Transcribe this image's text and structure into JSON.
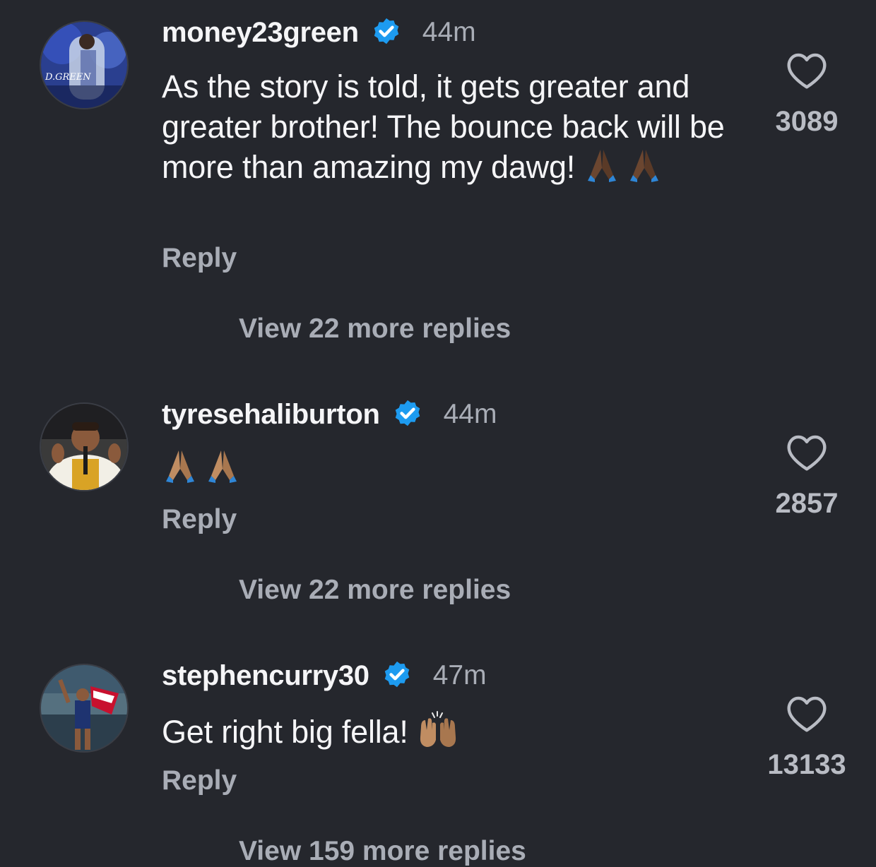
{
  "comments": [
    {
      "username": "money23green",
      "verified": true,
      "time": "44m",
      "text": "As the story is told, it gets greater and greater brother! The bounce back will be more than amazing my dawg!",
      "emojis": [
        "folded-hands-dark",
        "folded-hands-dark"
      ],
      "reply_label": "Reply",
      "likes": "3089",
      "view_more_label": "View 22 more replies",
      "avatar_text": "D.GREEN"
    },
    {
      "username": "tyresehaliburton",
      "verified": true,
      "time": "44m",
      "text": "",
      "emojis": [
        "folded-hands-medium",
        "folded-hands-medium"
      ],
      "reply_label": "Reply",
      "likes": "2857",
      "view_more_label": "View 22 more replies"
    },
    {
      "username": "stephencurry30",
      "verified": true,
      "time": "47m",
      "text": "Get right big fella!",
      "emojis": [
        "raising-hands-medium"
      ],
      "reply_label": "Reply",
      "likes": "13133",
      "view_more_label": "View 159 more replies"
    }
  ],
  "colors": {
    "background": "#25272d",
    "verified_badge": "#1d9bf0",
    "muted_text": "#a9adb6"
  }
}
